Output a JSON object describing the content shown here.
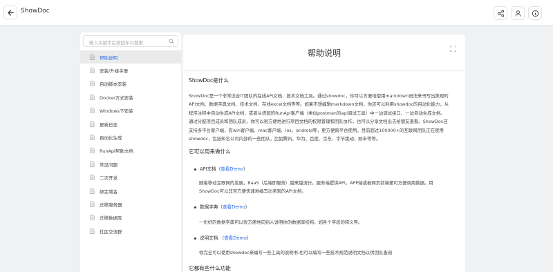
{
  "app": {
    "title": "ShowDoc"
  },
  "search": {
    "placeholder": "输入关键字后按回车以搜索"
  },
  "sidebar": {
    "items": [
      {
        "label": "帮助说明"
      },
      {
        "label": "安装/升级手册"
      },
      {
        "label": "自动脚本安装"
      },
      {
        "label": "Docker方式安装"
      },
      {
        "label": "Windows下安装"
      },
      {
        "label": "更新日志"
      },
      {
        "label": "自动化生成"
      },
      {
        "label": "RunApi帮助文档"
      },
      {
        "label": "常见问题"
      },
      {
        "label": "二次开发"
      },
      {
        "label": "绑定域名"
      },
      {
        "label": "迁移服务器"
      },
      {
        "label": "迁移数据库"
      },
      {
        "label": "社区交流群"
      }
    ]
  },
  "content": {
    "title": "帮助说明",
    "h1": "ShowDoc是什么",
    "p1_lines": [
      "ShowDoc是一个非常适合IT团队的在线API文档、技术文档工具。通过showdoc，你可以方便地使用markdown语法来书写出美观的",
      "API文档、数据字典文档、技术文档、在线excel文档等等。如果不想编辑markdown文档，你还可以利用showdoc的自动化能力，从",
      "程序注释中自动生成API文档，或者从搭配的RunApi客户端（类似postman的api调试工具）中一边调试接口、一边自动生成文档。",
      "通过分配项目成员和团队成员，你可以很方便地进行项目文档的权限管理和团队协作，也可以分享文档出去给朋友查看。ShowDoc还",
      "支持多平台客户端，有win客户端、mac客户端、ios、android等，更方便跨平台使用。目前超过100000+的互联网团队正在使用",
      "showdoc，包括知名公司内部的一些团队，比如腾讯、华为、百度、京东、字节跳动、顺丰等等。"
    ],
    "h2": "它可以用来做什么",
    "features": [
      {
        "label": "API文档（",
        "link": "查看Demo",
        "suffix": "）",
        "desc": [
          "随着移动互联网的发展，BaaS（后端即服务）越来越流行。服务端提供API，APP端或者网页前端便可方便调用数据。用",
          "ShowDoc可以非常方便快速地编写出美观的API文档。"
        ]
      },
      {
        "label": "数据字典（",
        "link": "查看Demo",
        "suffix": "）",
        "desc": [
          "一份好的数据字典可以很方便地向别人说明你的数据库结构，如各个字段的释义等。"
        ]
      },
      {
        "label": "说明文档 （",
        "link": "查看Demo",
        "suffix": "）",
        "desc": [
          "你完全可以使用showdoc来编写一些工具的说明书,也可以编写一些技术规范说明文档以供团队查阅"
        ]
      }
    ],
    "h3": "它都有些什么功能"
  }
}
